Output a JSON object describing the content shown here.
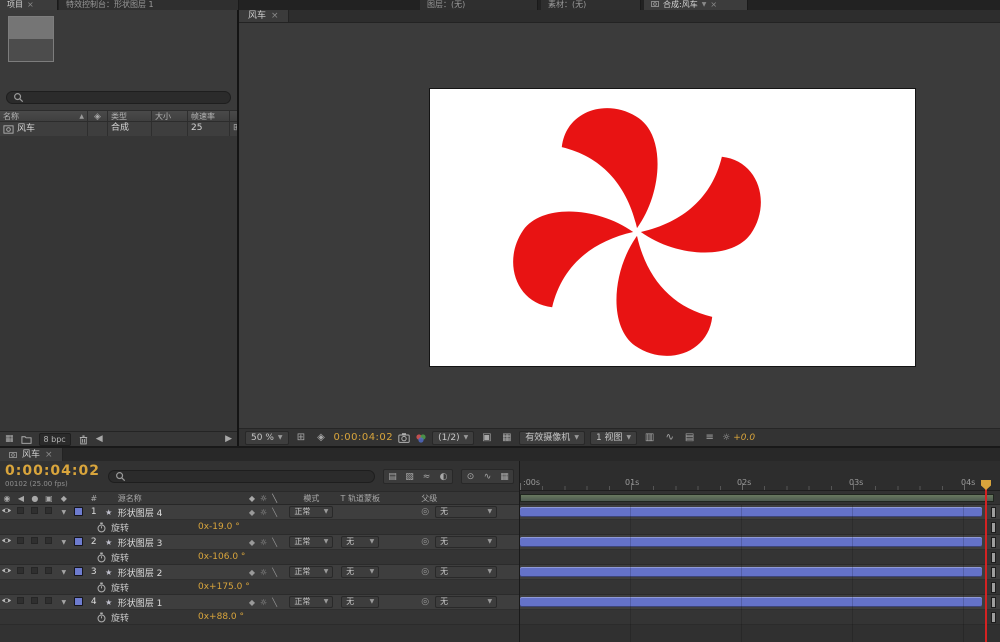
{
  "ui": {
    "tabs": {
      "project": "项目",
      "effect_controls": "特效控制台：形状图层 1",
      "layer": "图层：(无)",
      "footage": "素材：(无)",
      "composition": "合成:风车"
    }
  },
  "project_panel": {
    "columns": {
      "name": "名称",
      "type": "类型",
      "size": "大小",
      "framerate": "帧速率"
    },
    "item": {
      "name": "风车",
      "type": "合成",
      "size": "",
      "framerate": "25"
    },
    "bit_depth": "8 bpc"
  },
  "viewer": {
    "tab": "风车",
    "toolbar": {
      "zoom": "50 %",
      "timecode": "0:00:04:02",
      "resolution": "(1/2)",
      "camera": "有效摄像机",
      "view": "1 视图",
      "exposure": "+0.0"
    }
  },
  "pinwheel": {
    "color": "#e81313",
    "canvas_color": "#ffffff"
  },
  "timeline": {
    "tab": "风车",
    "timecode": "0:00:04:02",
    "frame_info": "00102 (25.00 fps)",
    "columns": {
      "hash": "#",
      "source_name": "源名称",
      "mode": "模式",
      "trkmat": "T 轨道蒙板",
      "parent": "父级"
    },
    "ruler": [
      ":00s",
      "01s",
      "02s",
      "03s",
      "04s"
    ],
    "layers": [
      {
        "num": "1",
        "name": "形状图层 4",
        "mode": "正常",
        "trkmat": "",
        "parent": "无",
        "prop_name": "旋转",
        "prop_value": "0x-19.0 °"
      },
      {
        "num": "2",
        "name": "形状图层 3",
        "mode": "正常",
        "trkmat": "无",
        "parent": "无",
        "prop_name": "旋转",
        "prop_value": "0x-106.0 °"
      },
      {
        "num": "3",
        "name": "形状图层 2",
        "mode": "正常",
        "trkmat": "无",
        "parent": "无",
        "prop_name": "旋转",
        "prop_value": "0x+175.0 °"
      },
      {
        "num": "4",
        "name": "形状图层 1",
        "mode": "正常",
        "trkmat": "无",
        "parent": "无",
        "prop_name": "旋转",
        "prop_value": "0x+88.0 °"
      }
    ]
  },
  "colors": {
    "accent": "#d9a53c",
    "layer_bar": "#6472c8",
    "cti_red": "#d42222",
    "wa_green": "#4e5a50",
    "wa_green_l": "#68795f",
    "label_blue": "#6e7cd0"
  }
}
